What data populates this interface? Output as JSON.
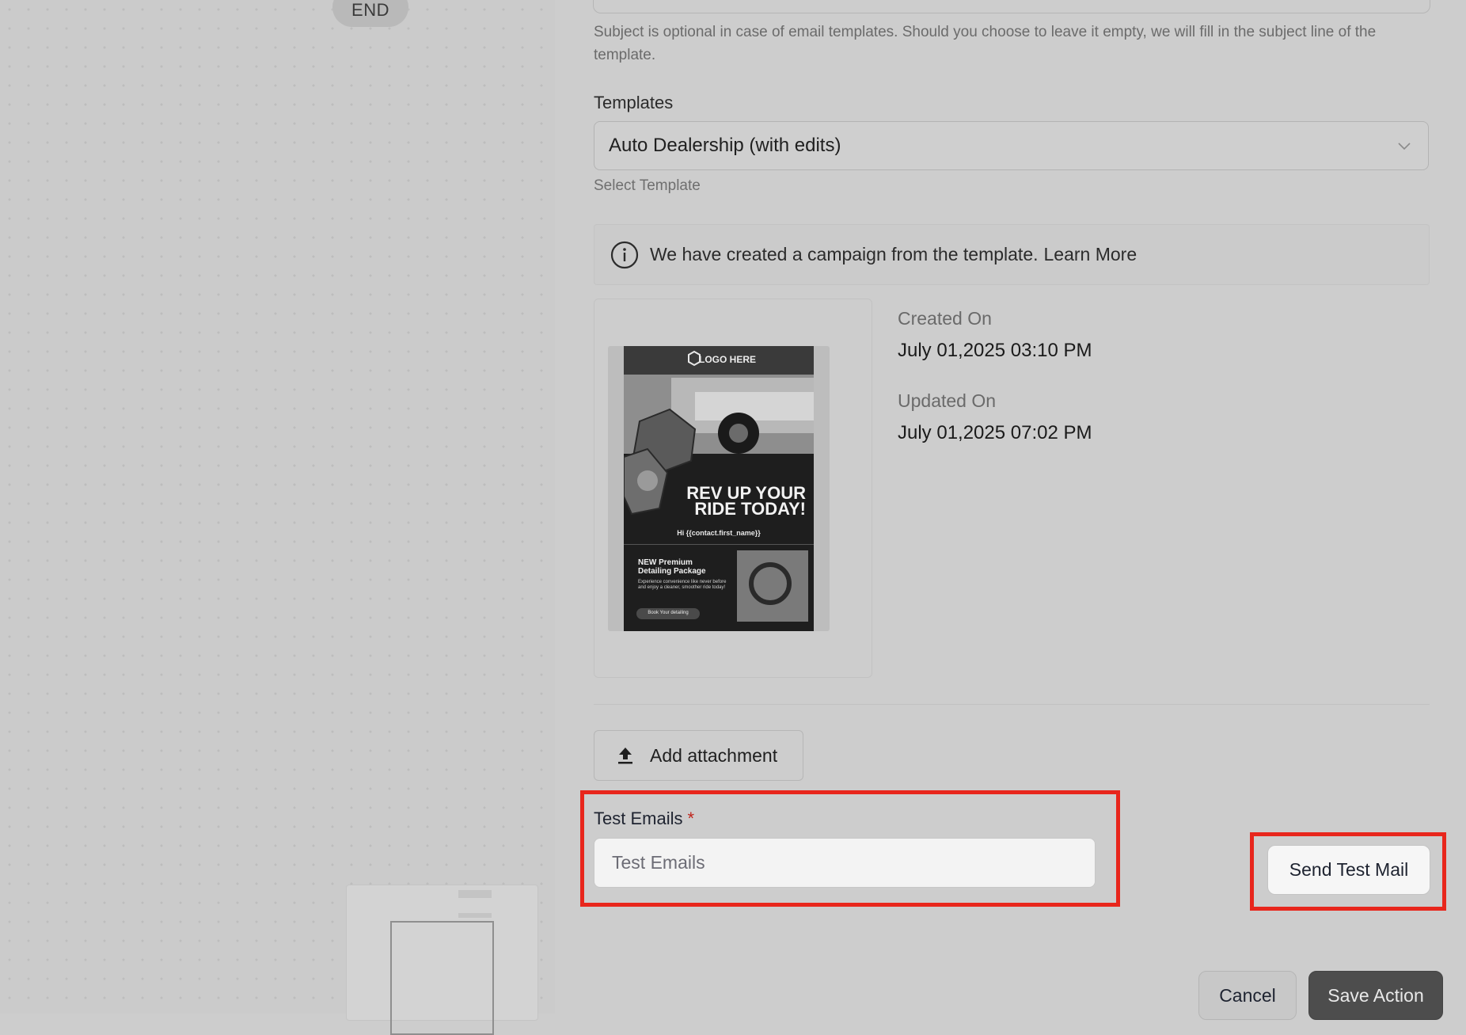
{
  "canvas": {
    "end_node_label": "END"
  },
  "form": {
    "subject_hint": "Subject is optional in case of email templates. Should you choose to leave it empty, we will fill in the subject line of the template.",
    "templates_label": "Templates",
    "templates_value": "Auto Dealership (with edits)",
    "templates_hint": "Select Template",
    "info_message": "We have created a campaign from the template.",
    "info_link": "Learn More",
    "created_label": "Created On",
    "created_value": "July 01,2025 03:10 PM",
    "updated_label": "Updated On",
    "updated_value": "July 01,2025 07:02 PM",
    "add_attachment_label": "Add attachment",
    "test_emails_label": "Test Emails",
    "test_emails_required": "*",
    "test_emails_placeholder": "Test Emails",
    "send_test_label": "Send Test Mail",
    "cancel_label": "Cancel",
    "save_label": "Save Action"
  },
  "preview": {
    "logo_text": "LOGO HERE",
    "headline_line1": "REV UP YOUR",
    "headline_line2": "RIDE TODAY!",
    "greeting": "Hi {{contact.first_name}}",
    "package_title_line1": "NEW Premium",
    "package_title_line2": "Detailing Package",
    "package_body": "Experience convenience like never before and enjoy a cleaner, smoother ride today!",
    "cta": "Book Your detailing"
  },
  "colors": {
    "highlight": "#e8261c",
    "required": "#c0241b",
    "primary_button": "#4d4d4d"
  }
}
